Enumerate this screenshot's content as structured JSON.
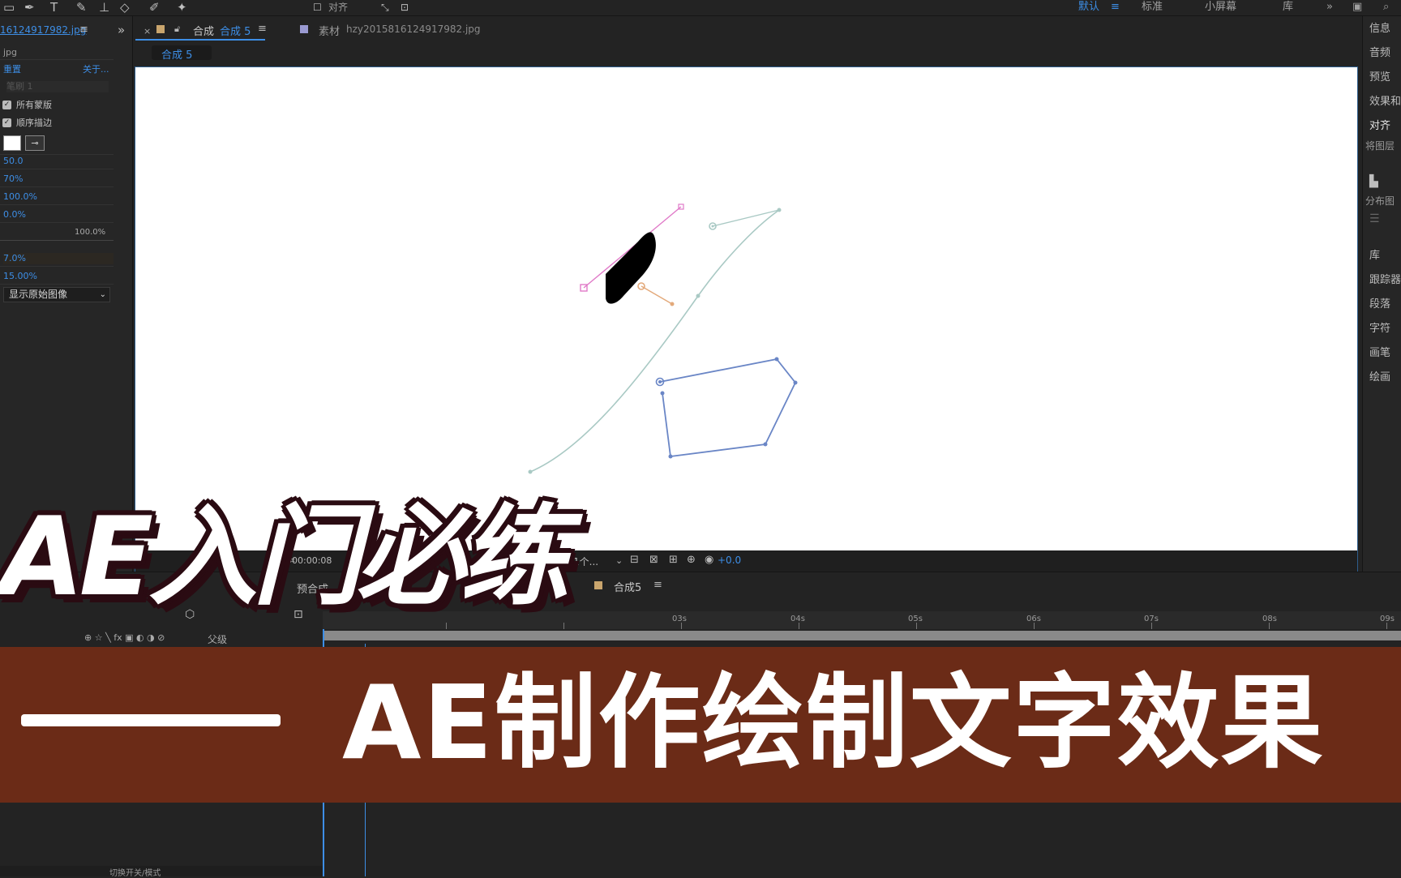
{
  "workspace": {
    "items": [
      "默认",
      "标准",
      "小屏幕",
      "库"
    ],
    "active_index": 0,
    "snap_label": "对齐"
  },
  "project": {
    "file_tab": "16124917982.jpg",
    "file_type": "jpg",
    "reset_label": "重置",
    "about_label": "关于...",
    "brush_dropdown": "笔刷 1",
    "all_masks_label": "所有蒙版",
    "sequential_label": "顺序描边",
    "values": [
      "50.0",
      "70%",
      "100.0%",
      "0.0%",
      "100.0%",
      "7.0%",
      "15.00%"
    ],
    "display_dropdown": "显示原始图像"
  },
  "composition": {
    "tab_label": "合成",
    "tab_name": "合成 5",
    "footage_label": "素材",
    "footage_file": "hzy2015816124917982.jpg",
    "breadcrumb": "合成 5",
    "timecode": "00:00:08",
    "view_count": "1个...",
    "exposure": "+0.0"
  },
  "right_panel": {
    "items": [
      "信息",
      "音频",
      "预览",
      "效果和",
      "对齐",
      "将图层",
      "分布图",
      "库",
      "跟踪器",
      "段落",
      "字符",
      "画笔",
      "绘画"
    ]
  },
  "timeline": {
    "comp_tab": "合成5",
    "precomp_label": "预合成",
    "parent_label": "父级",
    "switches_label": "切换开关/模式",
    "ticks": [
      "03s",
      "04s",
      "05s",
      "06s",
      "07s",
      "08s",
      "09s"
    ]
  },
  "overlay": {
    "headline": "AE入门必练",
    "banner": "AE制作绘制文字效果"
  },
  "colors": {
    "accent": "#3d8ee6",
    "banner_bg": "#6b2b17",
    "path_teal": "#a9c9c4",
    "path_blue": "#6a86c6",
    "path_pink": "#e07ac8",
    "path_orange": "#e3a97a"
  }
}
